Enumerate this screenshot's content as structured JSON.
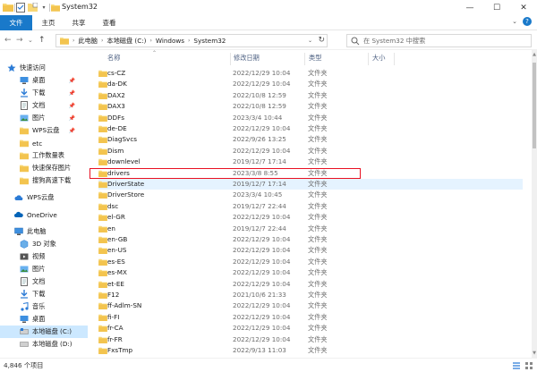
{
  "window": {
    "title": "System32",
    "quick_access_dropdown": "▾",
    "minimize": "—",
    "maximize": "☐",
    "close": "✕"
  },
  "ribbon": {
    "tabs": [
      "文件",
      "主页",
      "共享",
      "查看"
    ]
  },
  "address_bar": {
    "crumbs": [
      "此电脑",
      "本地磁盘 (C:)",
      "Windows",
      "System32"
    ],
    "separator": "›",
    "dropdown": "⌄",
    "refresh": "↻",
    "nav_back": "←",
    "nav_forward": "→",
    "nav_recent": "⌄",
    "nav_up": "↑"
  },
  "search": {
    "placeholder": "在 System32 中搜索"
  },
  "sidebar": {
    "quick_access": "快速访问",
    "pin_glyph": "📌",
    "items": [
      {
        "label": "桌面",
        "pinned": true,
        "icon": "desktop-icon"
      },
      {
        "label": "下载",
        "pinned": true,
        "icon": "download-icon"
      },
      {
        "label": "文档",
        "pinned": true,
        "icon": "document-icon"
      },
      {
        "label": "图片",
        "pinned": true,
        "icon": "pictures-icon"
      },
      {
        "label": "WPS云盘",
        "pinned": true,
        "icon": "folder-icon"
      },
      {
        "label": "etc",
        "pinned": false,
        "icon": "folder-icon"
      },
      {
        "label": "工作数量表",
        "pinned": false,
        "icon": "folder-icon"
      },
      {
        "label": "快速保存图片",
        "pinned": false,
        "icon": "folder-icon"
      },
      {
        "label": "搜狗高速下载",
        "pinned": false,
        "icon": "folder-icon"
      }
    ],
    "wps_cloud": "WPS云盘",
    "onedrive": "OneDrive",
    "this_pc": "此电脑",
    "pc_items": [
      {
        "label": "3D 对象",
        "icon": "3d-objects-icon"
      },
      {
        "label": "视频",
        "icon": "video-icon"
      },
      {
        "label": "图片",
        "icon": "pictures-icon"
      },
      {
        "label": "文档",
        "icon": "document-icon"
      },
      {
        "label": "下载",
        "icon": "download-icon"
      },
      {
        "label": "音乐",
        "icon": "music-icon"
      },
      {
        "label": "桌面",
        "icon": "desktop-icon"
      },
      {
        "label": "本地磁盘 (C:)",
        "icon": "drive-c-icon"
      },
      {
        "label": "本地磁盘 (D:)",
        "icon": "drive-d-icon"
      }
    ]
  },
  "columns": {
    "name": "名称",
    "date": "修改日期",
    "type": "类型",
    "size": "大小",
    "sort_caret": "⌃"
  },
  "files": [
    {
      "name": "cs-CZ",
      "date": "2022/12/29 10:04",
      "type": "文件夹"
    },
    {
      "name": "da-DK",
      "date": "2022/12/29 10:04",
      "type": "文件夹"
    },
    {
      "name": "DAX2",
      "date": "2022/10/8 12:59",
      "type": "文件夹"
    },
    {
      "name": "DAX3",
      "date": "2022/10/8 12:59",
      "type": "文件夹"
    },
    {
      "name": "DDFs",
      "date": "2023/3/4 10:44",
      "type": "文件夹"
    },
    {
      "name": "de-DE",
      "date": "2022/12/29 10:04",
      "type": "文件夹"
    },
    {
      "name": "DiagSvcs",
      "date": "2022/9/26 13:25",
      "type": "文件夹"
    },
    {
      "name": "Dism",
      "date": "2022/12/29 10:04",
      "type": "文件夹"
    },
    {
      "name": "downlevel",
      "date": "2019/12/7 17:14",
      "type": "文件夹"
    },
    {
      "name": "drivers",
      "date": "2023/3/8 8:55",
      "type": "文件夹"
    },
    {
      "name": "DriverState",
      "date": "2019/12/7 17:14",
      "type": "文件夹"
    },
    {
      "name": "DriverStore",
      "date": "2023/3/4 10:45",
      "type": "文件夹"
    },
    {
      "name": "dsc",
      "date": "2019/12/7 22:44",
      "type": "文件夹"
    },
    {
      "name": "el-GR",
      "date": "2022/12/29 10:04",
      "type": "文件夹"
    },
    {
      "name": "en",
      "date": "2019/12/7 22:44",
      "type": "文件夹"
    },
    {
      "name": "en-GB",
      "date": "2022/12/29 10:04",
      "type": "文件夹"
    },
    {
      "name": "en-US",
      "date": "2022/12/29 10:04",
      "type": "文件夹"
    },
    {
      "name": "es-ES",
      "date": "2022/12/29 10:04",
      "type": "文件夹"
    },
    {
      "name": "es-MX",
      "date": "2022/12/29 10:04",
      "type": "文件夹"
    },
    {
      "name": "et-EE",
      "date": "2022/12/29 10:04",
      "type": "文件夹"
    },
    {
      "name": "F12",
      "date": "2021/10/6 21:33",
      "type": "文件夹"
    },
    {
      "name": "ff-Adlm-SN",
      "date": "2022/12/29 10:04",
      "type": "文件夹"
    },
    {
      "name": "fi-FI",
      "date": "2022/12/29 10:04",
      "type": "文件夹"
    },
    {
      "name": "fr-CA",
      "date": "2022/12/29 10:04",
      "type": "文件夹"
    },
    {
      "name": "fr-FR",
      "date": "2022/12/29 10:04",
      "type": "文件夹"
    },
    {
      "name": "FxsTmp",
      "date": "2022/9/13 11:03",
      "type": "文件夹"
    }
  ],
  "status": {
    "item_count": "4,846 个项目"
  },
  "colors": {
    "accent": "#1979ca",
    "selection": "#cce8ff",
    "hover": "#e5f3ff",
    "folder": "#f8d775",
    "annotation": "#e81123"
  }
}
